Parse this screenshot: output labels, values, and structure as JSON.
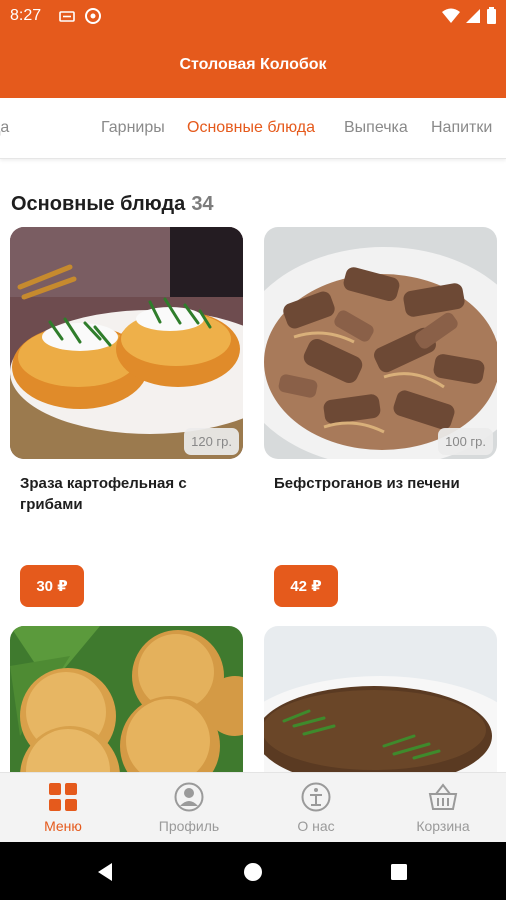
{
  "status_bar": {
    "time": "8:27"
  },
  "app": {
    "title": "Столовая Колобок",
    "accent": "#e55a1c"
  },
  "tabs": [
    {
      "label": "Первые блюда"
    },
    {
      "label": "Гарниры"
    },
    {
      "label": "Основные блюда",
      "active": true
    },
    {
      "label": "Выпечка"
    },
    {
      "label": "Напитки"
    }
  ],
  "section": {
    "title": "Основные блюда",
    "count": "34"
  },
  "products": [
    {
      "name": "Зраза картофельная с грибами",
      "weight": "120 гр.",
      "price": "30 ₽"
    },
    {
      "name": "Бефстроганов из печени",
      "weight": "100 гр.",
      "price": "42 ₽"
    },
    {
      "name": "",
      "weight": "",
      "price": ""
    },
    {
      "name": "",
      "weight": "",
      "price": ""
    }
  ],
  "bottom_nav": [
    {
      "label": "Меню",
      "icon": "grid-icon",
      "active": true
    },
    {
      "label": "Профиль",
      "icon": "profile-icon"
    },
    {
      "label": "О нас",
      "icon": "info-icon"
    },
    {
      "label": "Корзина",
      "icon": "basket-icon"
    }
  ]
}
